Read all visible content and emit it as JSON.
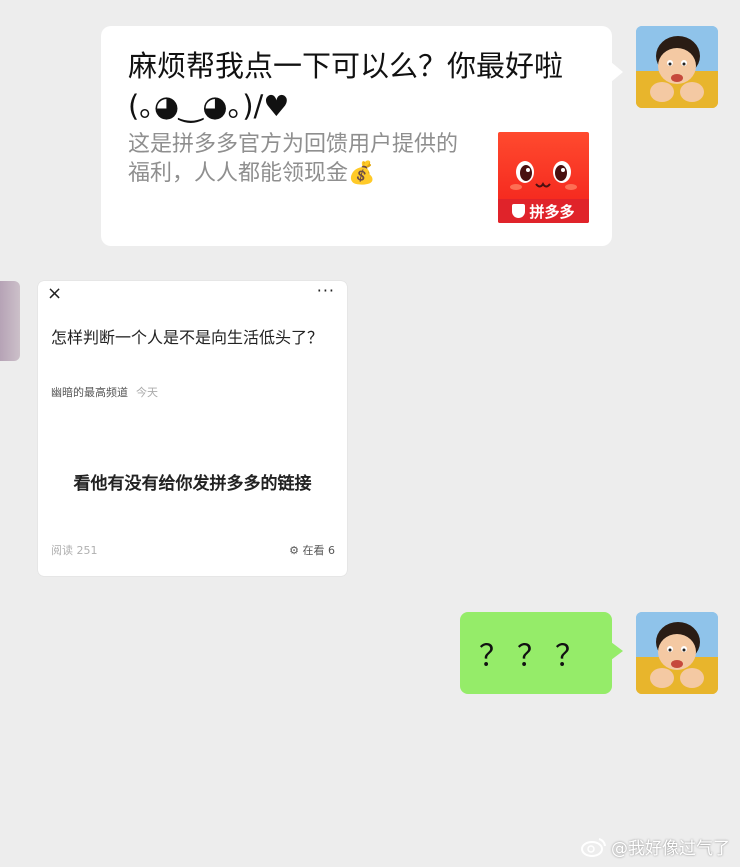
{
  "messages": {
    "link_card": {
      "title": "麻烦帮我点一下可以么？你最好啦 (｡◕‿◕｡)/♥",
      "description": "这是拼多多官方为回馈用户提供的福利，人人都能领现金💰",
      "app_label": "拼多多",
      "brand_color": "#f2201b"
    },
    "article": {
      "close_icon": "×",
      "more_icon": "···",
      "question": "怎样判断一个人是不是向生活低头了？",
      "author": "幽暗的最高频道",
      "time": "今天",
      "answer": "看他有没有给你发拼多多的链接",
      "reads": "阅读 251",
      "watching": "在看 6"
    },
    "reply": {
      "text": "？？？",
      "bubble_color": "#95ec69"
    }
  },
  "watermark": {
    "text": "@我好像过气了"
  }
}
